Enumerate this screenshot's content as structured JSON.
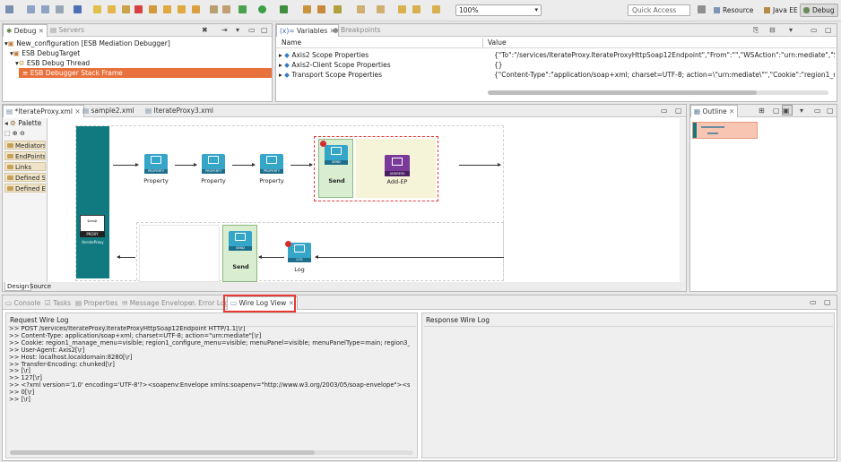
{
  "toolbar": {
    "zoom": "100%",
    "quick_access_placeholder": "Quick Access",
    "perspectives": [
      "Resource",
      "Java EE",
      "Debug"
    ]
  },
  "debug_view": {
    "tabs": [
      "Debug",
      "Servers"
    ],
    "tree": [
      "New_configuration [ESB Mediation Debugger]",
      "ESB DebugTarget",
      "ESB Debug Thread",
      "ESB Debugger Stack Frame"
    ]
  },
  "variables_view": {
    "tabs": [
      "Variables",
      "Breakpoints"
    ],
    "columns": [
      "Name",
      "Value"
    ],
    "rows": [
      {
        "name": "Axis2 Scope Properties",
        "value": "{\"To\":\"/services/IterateProxy.IterateProxyHttpSoap12Endpoint\",\"From\":\"\",\"WSAction\":\"urn:mediate\",\"SOAPAc"
      },
      {
        "name": "Axis2-Client Scope Properties",
        "value": "{}"
      },
      {
        "name": "Transport Scope Properties",
        "value": "{\"Content-Type\":\"application/soap+xml; charset=UTF-8; action=\\\"urn:mediate\\\"\",\"Cookie\":\"region1_manage_r"
      }
    ]
  },
  "editor": {
    "tabs": [
      "*IterateProxy.xml",
      "sample2.xml",
      "IterateProxy3.xml"
    ],
    "palette": {
      "title": "Palette",
      "groups": [
        "Mediators",
        "EndPoints",
        "Links",
        "Defined Sequen...",
        "Defined EndPoi..."
      ]
    },
    "proxy": {
      "badge": "PROXY",
      "name": "IterateProxy"
    },
    "mediators": {
      "property_badge": "PROPERTY",
      "property_label": "Property",
      "send_badge": "SEND",
      "send_label": "Send",
      "address_badge": "ADDRESS",
      "address_label": "Add-EP",
      "log_badge": "LOG",
      "log_label": "Log"
    },
    "bottom_tabs": [
      "Design",
      "Source"
    ]
  },
  "outline_view": {
    "title": "Outline"
  },
  "bottom_panel": {
    "tabs": [
      "Console",
      "Tasks",
      "Properties",
      "Message Envelope",
      "Error Log",
      "Wire Log View"
    ],
    "request_title": "Request Wire Log",
    "response_title": "Response Wire Log",
    "request_log": ">> POST /services/IterateProxy.IterateProxyHttpSoap12Endpoint HTTP/1.1[\\r]\n>> Content-Type: application/soap+xml; charset=UTF-8; action=\"urn:mediate\"[\\r]\n>> Cookie: region1_manage_menu=visible; region1_configure_menu=visible; menuPanel=visible; menuPanelType=main; region3_regis\n>> User-Agent: Axis2[\\r]\n>> Host: localhost.localdomain:8280[\\r]\n>> Transfer-Encoding: chunked[\\r]\n>> [\\r]\n>> 127[\\r]\n>> <?xml version='1.0' encoding='UTF-8'?><soapenv:Envelope xmlns:soapenv=\"http://www.w3.org/2003/05/soap-envelope\"><soapen\n>> 0[\\r]\n>> [\\r]"
  },
  "colors": {
    "accent": "#e9713c",
    "highlight": "#e53935",
    "mediator": "#35a6c8",
    "proxy": "#117a80"
  }
}
